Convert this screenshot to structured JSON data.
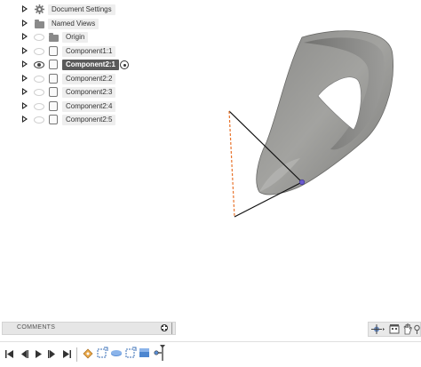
{
  "browser": {
    "items": [
      {
        "label": "Document Settings",
        "icon": "gear-icon",
        "active": false
      },
      {
        "label": "Named Views",
        "icon": "folder-icon",
        "active": false
      },
      {
        "label": "Origin",
        "icon": "folder-icon",
        "active": false
      },
      {
        "label": "Component1:1",
        "icon": "component-icon",
        "active": false
      },
      {
        "label": "Component2:1",
        "icon": "component-icon",
        "active": true
      },
      {
        "label": "Component2:2",
        "icon": "component-icon",
        "active": false
      },
      {
        "label": "Component2:3",
        "icon": "component-icon",
        "active": false
      },
      {
        "label": "Component2:4",
        "icon": "component-icon",
        "active": false
      },
      {
        "label": "Component2:5",
        "icon": "component-icon",
        "active": false
      }
    ]
  },
  "comments": {
    "label": "COMMENTS"
  },
  "colors": {
    "active_row": "#5a5a5a",
    "row_bg": "#eeeeee",
    "sketch_line": "#e8722a",
    "point": "#6a5acd"
  }
}
